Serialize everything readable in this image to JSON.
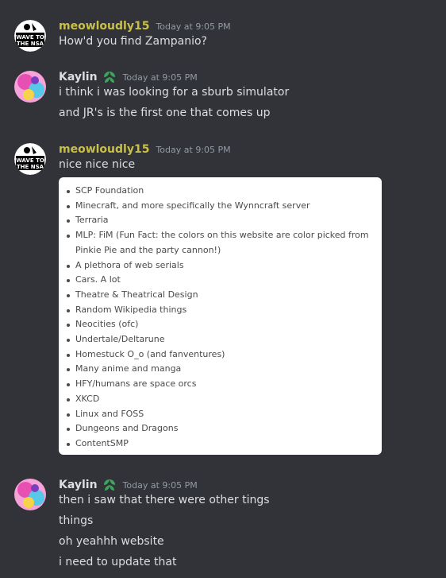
{
  "users": {
    "meow": {
      "name": "meowloudly15",
      "color": "#c9c04a",
      "avatar_text": [
        "WAVE TO",
        "THE NSA"
      ]
    },
    "kaylin": {
      "name": "Kaylin",
      "color": "#dbdee1",
      "badge": "green-leaf-icon"
    }
  },
  "messages": [
    {
      "author": "meowloudly15",
      "time": "Today at 9:05 PM",
      "lines": [
        "How'd you find Zampanio?"
      ]
    },
    {
      "author": "Kaylin",
      "time": "Today at 9:05 PM",
      "lines": [
        "i think i was looking for a sburb simulator",
        "and JR's is the first one that comes up"
      ]
    },
    {
      "author": "meowloudly15",
      "time": "Today at 9:05 PM",
      "lines": [
        "nice nice nice"
      ]
    },
    {
      "author": "Kaylin",
      "time": "Today at 9:05 PM",
      "lines": [
        "then i saw that there were other tings",
        "things",
        "oh yeahhh website",
        "i need to update that"
      ]
    }
  ],
  "embed_list": [
    "SCP Foundation",
    "Minecraft, and more specifically the Wynncraft server",
    "Terraria",
    "MLP: FiM (Fun Fact: the colors on this website are color picked from Pinkie Pie and the party cannon!)",
    "A plethora of web serials",
    "Cars. A lot",
    "Theatre & Theatrical Design",
    "Random Wikipedia things",
    "Neocities (ofc)",
    "Undertale/Deltarune",
    "Homestuck O_o (and fanventures)",
    "Many anime and manga",
    "HFY/humans are space orcs",
    "XKCD",
    "Linux and FOSS",
    "Dungeons and Dragons",
    "ContentSMP"
  ]
}
